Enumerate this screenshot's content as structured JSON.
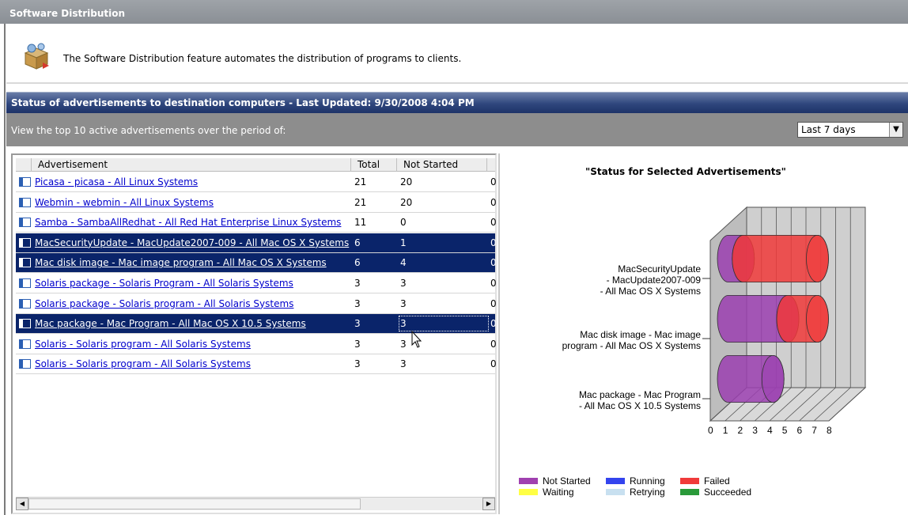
{
  "window": {
    "title": "Software Distribution"
  },
  "intro": {
    "text": "The Software Distribution feature automates the distribution of programs to clients."
  },
  "section": {
    "header": "Status of advertisements to destination computers - Last Updated: 9/30/2008 4:04 PM"
  },
  "filter": {
    "label": "View the top 10 active advertisements over the period of:",
    "period": "Last 7 days"
  },
  "grid": {
    "columns": [
      "Advertisement",
      "Total",
      "Not Started"
    ],
    "rows": [
      {
        "name": "Picasa - picasa - All Linux Systems",
        "total": "21",
        "not_started": "20",
        "next": "0",
        "selected": false
      },
      {
        "name": "Webmin - webmin - All Linux Systems",
        "total": "21",
        "not_started": "20",
        "next": "0",
        "selected": false
      },
      {
        "name": "Samba - SambaAllRedhat - All Red Hat Enterprise Linux Systems",
        "total": "11",
        "not_started": "0",
        "next": "0",
        "selected": false
      },
      {
        "name": "MacSecurityUpdate - MacUpdate2007-009 - All Mac OS X Systems",
        "total": "6",
        "not_started": "1",
        "next": "0",
        "selected": true
      },
      {
        "name": "Mac disk image - Mac image program - All Mac OS X Systems",
        "total": "6",
        "not_started": "4",
        "next": "0",
        "selected": true
      },
      {
        "name": "Solaris package - Solaris Program - All Solaris Systems",
        "total": "3",
        "not_started": "3",
        "next": "0",
        "selected": false
      },
      {
        "name": "Solaris package - Solaris program - All Solaris Systems",
        "total": "3",
        "not_started": "3",
        "next": "0",
        "selected": false
      },
      {
        "name": "Mac package - Mac Program - All Mac OS X 10.5 Systems",
        "total": "3",
        "not_started": "3",
        "next": "0",
        "selected": true
      },
      {
        "name": "Solaris - Solaris program - All Solaris Systems",
        "total": "3",
        "not_started": "3",
        "next": "0",
        "selected": false
      },
      {
        "name": "Solaris - Solaris program - All Solaris Systems",
        "total": "3",
        "not_started": "3",
        "next": "0",
        "selected": false
      }
    ]
  },
  "chart_data": {
    "type": "bar",
    "title": "\"Status for Selected Advertisements\"",
    "orientation": "horizontal-stacked-3d",
    "categories": [
      "MacSecurityUpdate - MacUpdate2007-009 - All Mac OS X Systems",
      "Mac disk image - Mac image program - All Mac OS X Systems",
      "Mac package - Mac Program - All Mac OS X 10.5 Systems"
    ],
    "category_lines": [
      [
        "MacSecurityUpdate",
        "- MacUpdate2007-009",
        "- All Mac OS X Systems"
      ],
      [
        "Mac disk image - Mac image",
        "program - All Mac OS X Systems"
      ],
      [
        "Mac package - Mac Program",
        "- All Mac OS X 10.5 Systems"
      ]
    ],
    "series": [
      {
        "name": "Not Started",
        "color": "#9b3fb0",
        "values": [
          1,
          4,
          3
        ]
      },
      {
        "name": "Failed",
        "color": "#f03a3a",
        "values": [
          5,
          2,
          0
        ]
      }
    ],
    "xlim": [
      0,
      8
    ],
    "xticks": [
      "0",
      "1",
      "2",
      "3",
      "4",
      "5",
      "6",
      "7",
      "8"
    ],
    "legend": [
      {
        "name": "Not Started",
        "color": "#a040b0"
      },
      {
        "name": "Running",
        "color": "#3344ee"
      },
      {
        "name": "Failed",
        "color": "#f03a3a"
      },
      {
        "name": "Waiting",
        "color": "#ffff44"
      },
      {
        "name": "Retrying",
        "color": "#c8e0f0"
      },
      {
        "name": "Succeeded",
        "color": "#2a9a3a"
      }
    ],
    "legend_position": "bottom-left"
  }
}
